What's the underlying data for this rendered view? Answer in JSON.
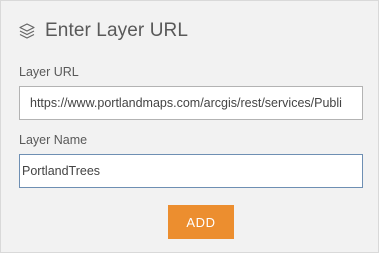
{
  "header": {
    "icon": "layers-icon",
    "title": "Enter Layer URL"
  },
  "form": {
    "url_label": "Layer URL",
    "url_value": "https://www.portlandmaps.com/arcgis/rest/services/Publi",
    "name_label": "Layer Name",
    "name_value": "PortlandTrees"
  },
  "actions": {
    "add_label": "ADD"
  },
  "colors": {
    "panel_bg": "#f2f2f2",
    "accent_button": "#ec8e2f",
    "focused_border": "#6e8fb3"
  }
}
